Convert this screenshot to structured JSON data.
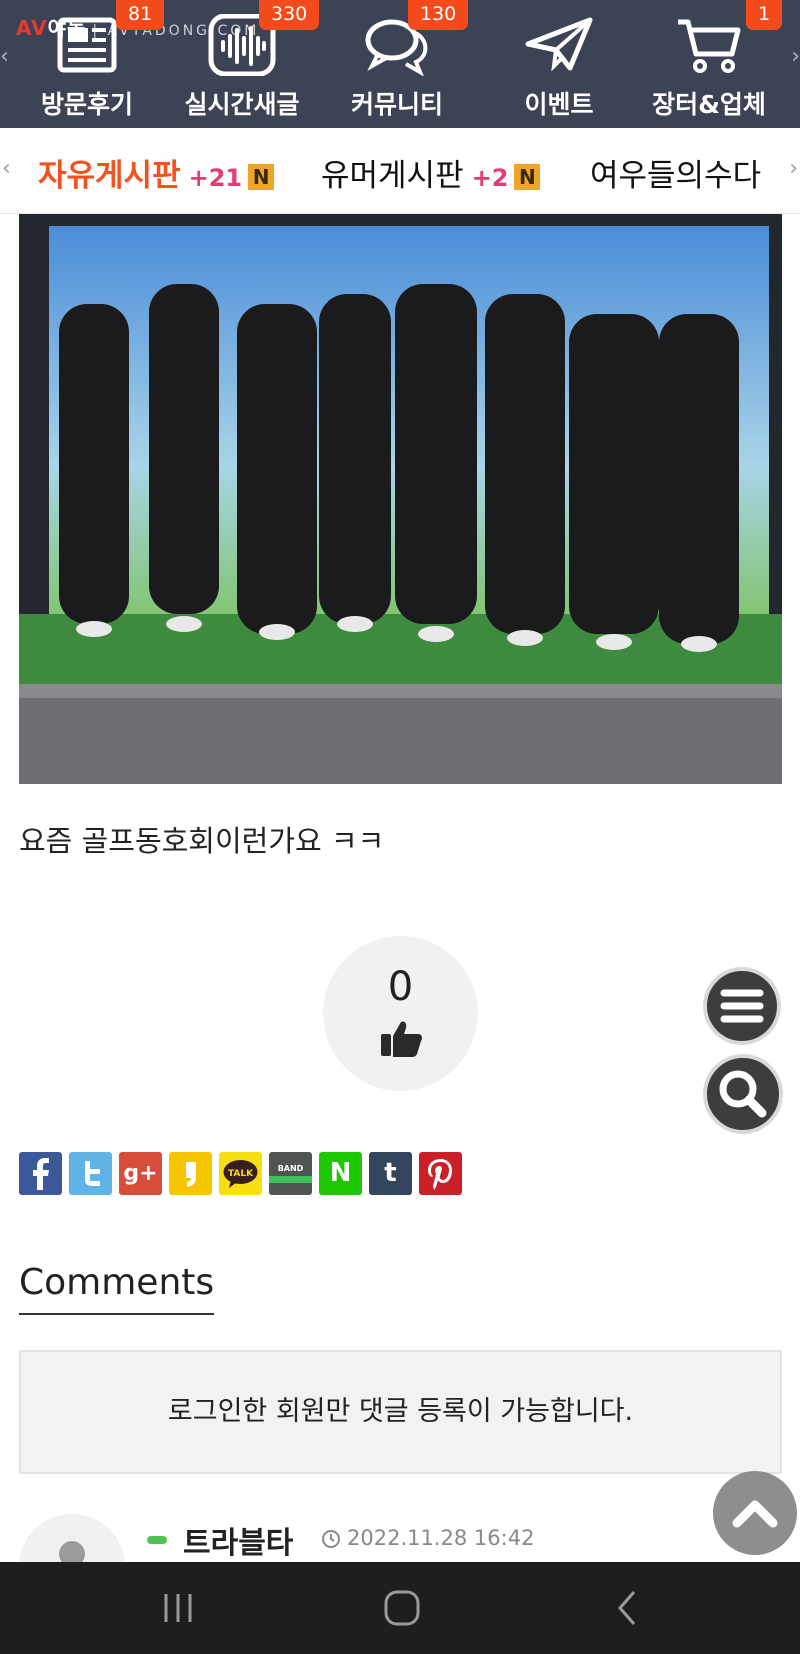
{
  "site": {
    "logo_av": "AV",
    "logo_name": "야동",
    "logo_url": "| AVYADONG.COM"
  },
  "nav": {
    "items": [
      {
        "label": "방문후기",
        "badge": "81",
        "icon": "newspaper-icon"
      },
      {
        "label": "실시간새글",
        "badge": "330",
        "icon": "soundwave-icon"
      },
      {
        "label": "커뮤니티",
        "badge": "130",
        "icon": "chat-bubbles-icon"
      },
      {
        "label": "이벤트",
        "badge": "",
        "icon": "paper-plane-icon"
      },
      {
        "label": "장터&업체",
        "badge": "1",
        "icon": "shopping-cart-icon"
      }
    ],
    "badge_color": "#f34b1c"
  },
  "tabs": [
    {
      "label": "자유게시판",
      "count": "+21",
      "new": "N"
    },
    {
      "label": "유머게시판",
      "count": "+2",
      "new": "N"
    },
    {
      "label": "여우들의수다",
      "count": "",
      "new": ""
    }
  ],
  "post": {
    "text": "요즘 골프동호회이런가요 ㅋㅋ",
    "likes": "0"
  },
  "share": [
    "facebook-icon",
    "twitter-icon",
    "google-plus-icon",
    "kakaostory-icon",
    "kakaotalk-icon",
    "band-icon",
    "naver-icon",
    "tumblr-icon",
    "pinterest-icon"
  ],
  "share_labels": {
    "gplus": "g+",
    "talk": "TALK",
    "band": "BAND",
    "naver": "N",
    "tumblr": "t"
  },
  "comments": {
    "title": "Comments",
    "login_notice": "로그인한 회원만 댓글 등록이 가능합니다.",
    "items": [
      {
        "author": "트라블타",
        "date": "2022.11.28 16:42"
      }
    ]
  },
  "colors": {
    "nav_bg": "#3c4354",
    "accent": "#f2521f",
    "count": "#e53d6f",
    "new_badge": "#f0a52a"
  }
}
